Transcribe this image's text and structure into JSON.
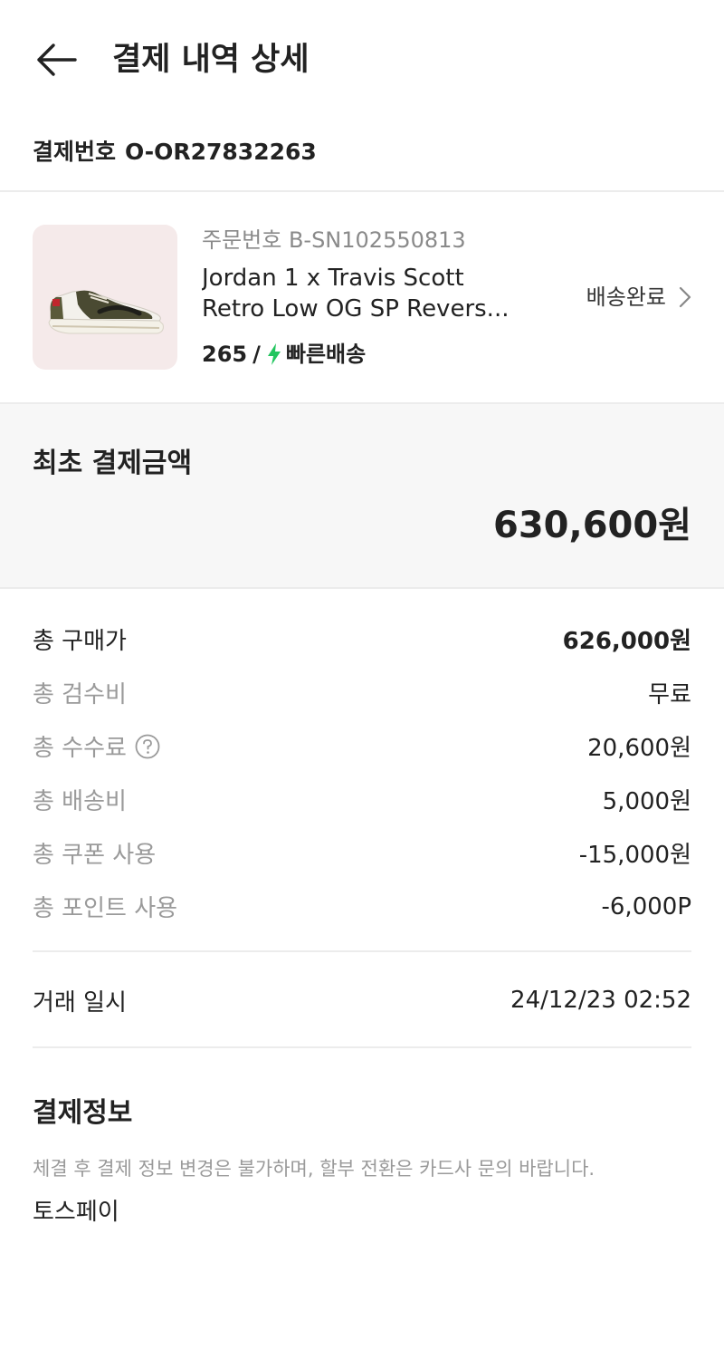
{
  "header": {
    "title": "결제 내역 상세",
    "back_icon": "arrow-left-icon"
  },
  "payment": {
    "label": "결제번호",
    "number": "O-OR27832263"
  },
  "product": {
    "order_number": "주문번호 B-SN102550813",
    "name_line1": "Jordan 1 x Travis Scott",
    "name_line2": "Retro Low OG SP Revers...",
    "size": "265",
    "shipping_label": "빠른배송",
    "shipping_icon": "lightning-icon",
    "status": "배송완료",
    "status_icon": "chevron-right-icon",
    "colors": {
      "bolt": "#22c55e",
      "thumb_bg": "#f5eaea"
    }
  },
  "summary": {
    "label": "최초 결제금액",
    "amount": "630,600원"
  },
  "breakdown": [
    {
      "label": "총 구매가",
      "value": "626,000원"
    },
    {
      "label": "총 검수비",
      "value": "무료"
    },
    {
      "label": "총 수수료",
      "value": "20,600원"
    },
    {
      "label": "총 배송비",
      "value": "5,000원"
    },
    {
      "label": "총 쿠폰 사용",
      "value": "-15,000원"
    },
    {
      "label": "총 포인트 사용",
      "value": "-6,000P"
    }
  ],
  "trade": {
    "label": "거래 일시",
    "value": "24/12/23 02:52"
  },
  "payment_info": {
    "title": "결제정보",
    "note": "체결 후 결제 정보 변경은 불가하며, 할부 전환은 카드사 문의 바랍니다.",
    "method": "토스페이"
  }
}
